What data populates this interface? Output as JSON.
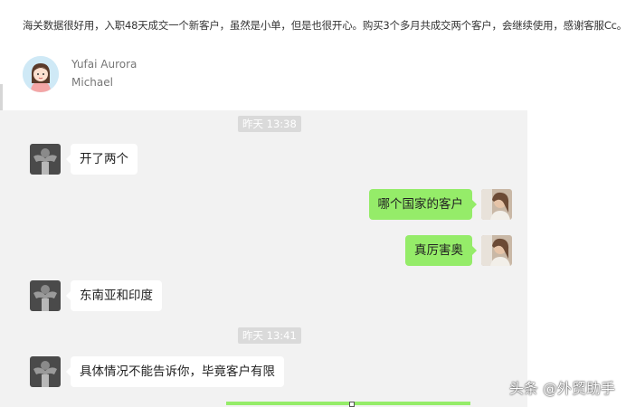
{
  "review": {
    "text": "海关数据很好用，入职48天成交一个新客户，虽然是小单，但是也很开心。购买3个多月共成交两个客户，会继续使用，感谢客服Cc。"
  },
  "profile": {
    "name": "Yufai Aurora",
    "subtitle": "Michael"
  },
  "chat": {
    "timestamps": [
      "昨天 13:38",
      "昨天 13:41"
    ],
    "messages": [
      {
        "side": "left",
        "text": "开了两个"
      },
      {
        "side": "right",
        "text": "哪个国家的客户"
      },
      {
        "side": "right",
        "text": "真厉害奥"
      },
      {
        "side": "left",
        "text": "东南亚和印度"
      },
      {
        "side": "left",
        "text": "具体情况不能告诉你，毕竟客户有限"
      }
    ]
  },
  "watermark": "头条 @外贸助手",
  "colors": {
    "chat_bg": "#f2f2f2",
    "outgoing_bubble": "#95ec69",
    "incoming_bubble": "#ffffff",
    "timestamp_bg": "#dadada"
  }
}
